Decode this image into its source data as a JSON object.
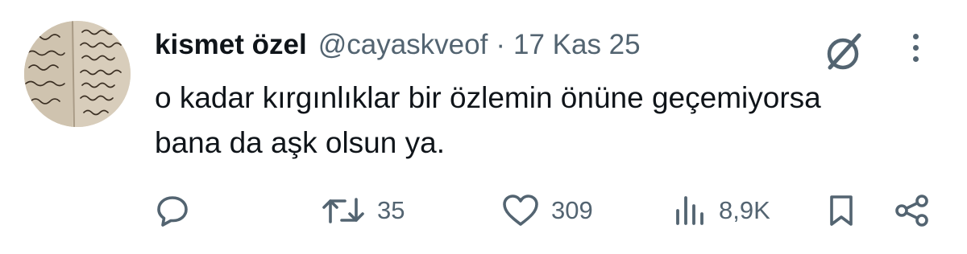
{
  "tweet": {
    "author_name": "kismet özel",
    "handle": "@cayaskveof",
    "separator": "·",
    "date": "17 Kas 25",
    "text_lines": [
      "o kadar kırgınlıklar bir özlemin önüne geçemiyorsa",
      "bana da aşk olsun ya."
    ],
    "avatar_words": [
      "sken",
      "hayal",
      "sevda",
      "sualorı",
      "yolda",
      "wanın",
      "keşifli",
      "tomandır",
      "kurdum",
      "çağını",
      "fresbru",
      "çöl",
      "yolla"
    ]
  },
  "actions": {
    "reply": {
      "icon": "reply-icon"
    },
    "retweet": {
      "icon": "retweet-icon",
      "count": "35"
    },
    "like": {
      "icon": "heart-icon",
      "count": "309"
    },
    "views": {
      "icon": "views-icon",
      "count": "8,9K"
    },
    "bookmark": {
      "icon": "bookmark-icon"
    },
    "share": {
      "icon": "share-icon"
    }
  },
  "colors": {
    "text": "#0f1419",
    "secondary": "#536471",
    "background": "#ffffff"
  }
}
